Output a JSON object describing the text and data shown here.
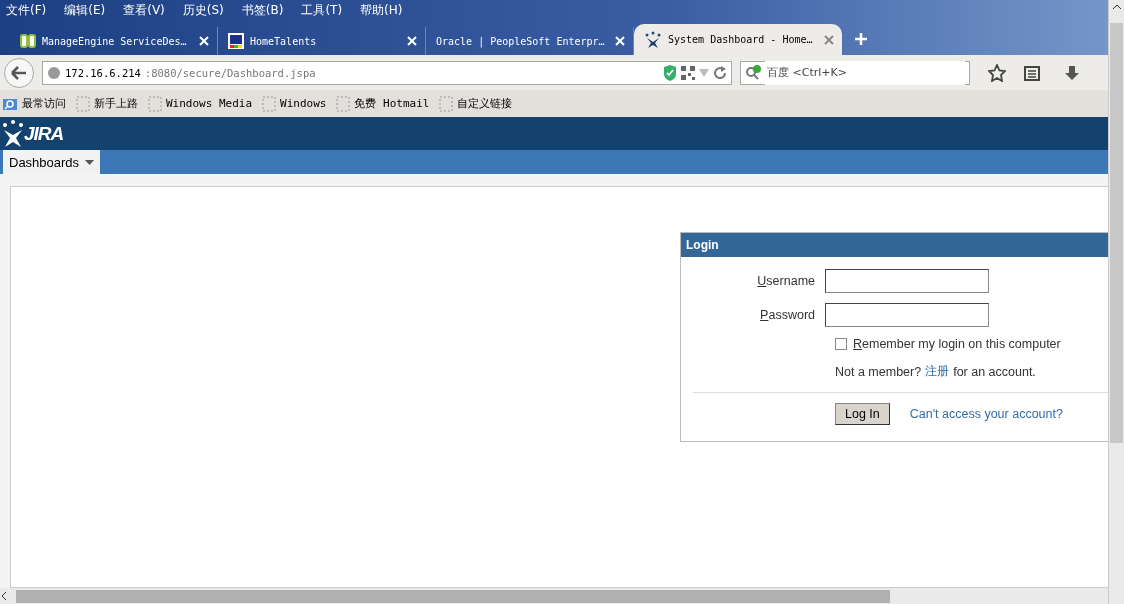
{
  "menu": [
    "文件(F)",
    "编辑(E)",
    "查看(V)",
    "历史(S)",
    "书签(B)",
    "工具(T)",
    "帮助(H)"
  ],
  "tabs": [
    {
      "title": "ManageEngine ServiceDes…",
      "kind": "servicedesk",
      "selected": false
    },
    {
      "title": "HomeTalents",
      "kind": "hometalents",
      "selected": false
    },
    {
      "title": "Oracle | PeopleSoft Enterpr…",
      "kind": "none",
      "selected": false
    },
    {
      "title": "System Dashboard - Home…",
      "kind": "jira",
      "selected": true
    }
  ],
  "address": {
    "host": "172.16.6.214",
    "path": ":8080/secure/Dashboard.jspa"
  },
  "search": {
    "placeholder": "百度 <Ctrl+K>"
  },
  "bookmarks": [
    {
      "label": "最常访问",
      "kind": "smart"
    },
    {
      "label": "新手上路",
      "kind": "page"
    },
    {
      "label": "Windows Media",
      "kind": "page"
    },
    {
      "label": "Windows",
      "kind": "page"
    },
    {
      "label": "免费 Hotmail",
      "kind": "page"
    },
    {
      "label": "自定义链接",
      "kind": "page"
    }
  ],
  "jira": {
    "logo": "JIRA",
    "nav": [
      {
        "label": "Dashboards",
        "selected": true
      }
    ]
  },
  "login": {
    "title": "Login",
    "fields": [
      {
        "label": "Username"
      },
      {
        "label": "Password"
      }
    ],
    "remember": {
      "label": "Remember my login on this computer",
      "checked": false
    },
    "signup": {
      "before": "Not a member?",
      "link": "注册",
      "after": "for an account."
    },
    "button": "Log In",
    "help_link": "Can't access your account?"
  }
}
